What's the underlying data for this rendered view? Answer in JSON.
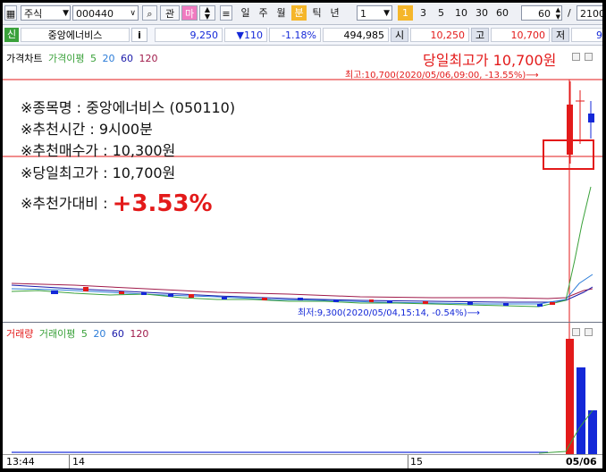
{
  "toolbar": {
    "market": "주식",
    "code": "000440",
    "btn_view": "관",
    "btn_ma": "마",
    "period_tabs": [
      "일",
      "주",
      "월",
      "분",
      "틱",
      "년"
    ],
    "active_period": "분",
    "interval": "1",
    "interval_badge": "1",
    "interval_options": [
      "3",
      "5",
      "10",
      "30",
      "60"
    ],
    "count": "60",
    "slash": "/",
    "total": "2100"
  },
  "quote": {
    "type_label": "신",
    "stock_name": "중앙에너비스",
    "info_label": "i",
    "price": "9,250",
    "change": "▼110",
    "change_pct": "-1.18%",
    "volume": "494,985",
    "open_label": "시",
    "open": "10,250",
    "high_label": "고",
    "high": "10,700",
    "low_label": "저",
    "low": "9"
  },
  "price_panel": {
    "legend_title": "가격차트",
    "legend_ma": "가격이평",
    "ma_periods": [
      "5",
      "20",
      "60",
      "120"
    ],
    "ma_colors": [
      "#3aa13a",
      "#2b7cd8",
      "#1a1aaa",
      "#a01a4a"
    ],
    "day_high_banner": "당일최고가 10,700원",
    "high_annotation": "최고:10,700(2020/05/06,09:00, -13.55%)⟶",
    "low_annotation": "최저:9,300(2020/05/04,15:14, -0.54%)⟶"
  },
  "overlay": {
    "line1": "※종목명 : 중앙에너비스 (050110)",
    "line2": "※추천시간 : 9시00분",
    "line3": "※추천매수가 : 10,300원",
    "line4": "※당일최고가 : 10,700원",
    "line5_label": "※추천가대비 : ",
    "line5_value": "+3.53%"
  },
  "volume_panel": {
    "legend_title": "거래량",
    "legend_ma": "거래이평",
    "ma_periods": [
      "5",
      "20",
      "60",
      "120"
    ]
  },
  "time_axis": {
    "labels": [
      "13:44",
      "14",
      "15",
      "05/06"
    ]
  },
  "colors": {
    "up": "#e31a1a",
    "down": "#1428d8",
    "annotation_red": "#e31a1a",
    "annotation_blue": "#1428d8"
  }
}
